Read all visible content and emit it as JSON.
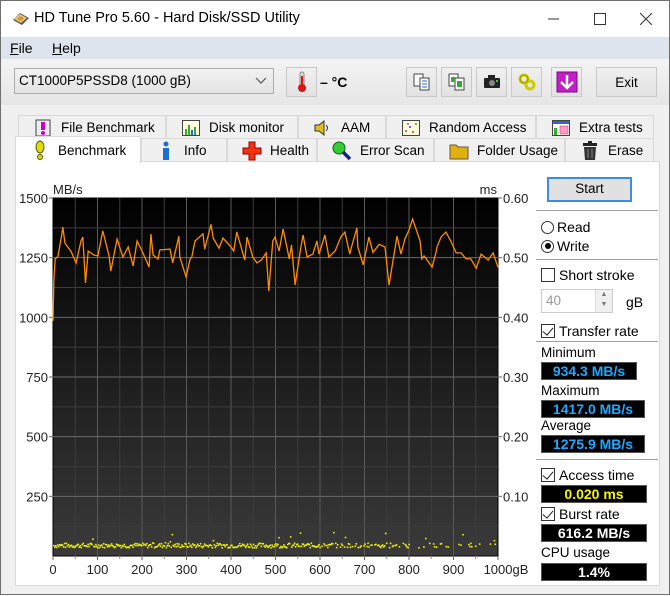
{
  "window": {
    "title": "HD Tune Pro 5.60 - Hard Disk/SSD Utility",
    "icon": "hard-disk-icon",
    "controls": [
      "minimize",
      "maximize",
      "close"
    ]
  },
  "menu": {
    "items": [
      {
        "label": "File",
        "mnemonic": "F",
        "rest": "ile"
      },
      {
        "label": "Help",
        "mnemonic": "H",
        "rest": "elp"
      }
    ]
  },
  "toolbar": {
    "drive": "CT1000P5PSSD8 (1000 gB)",
    "temperature": "– °C",
    "buttons": [
      "copy-text-icon",
      "copy-screenshot-icon",
      "camera-icon",
      "options-icon",
      "save-down-icon"
    ],
    "exit_label": "Exit"
  },
  "tabs": {
    "row1": [
      {
        "label": "File Benchmark",
        "icon": "file-benchmark-icon"
      },
      {
        "label": "Disk monitor",
        "icon": "disk-monitor-icon"
      },
      {
        "label": "AAM",
        "icon": "speaker-icon"
      },
      {
        "label": "Random Access",
        "icon": "random-access-icon"
      },
      {
        "label": "Extra tests",
        "icon": "extra-tests-icon"
      }
    ],
    "row2": [
      {
        "label": "Benchmark",
        "icon": "benchmark-icon",
        "active": true
      },
      {
        "label": "Info",
        "icon": "info-icon"
      },
      {
        "label": "Health",
        "icon": "health-cross-icon"
      },
      {
        "label": "Error Scan",
        "icon": "magnifier-icon"
      },
      {
        "label": "Folder Usage",
        "icon": "folder-icon"
      },
      {
        "label": "Erase",
        "icon": "trash-icon"
      }
    ]
  },
  "side": {
    "start_label": "Start",
    "read_label": "Read",
    "write_label": "Write",
    "mode": "Write",
    "short_stroke_label": "Short stroke",
    "short_stroke_checked": false,
    "short_stroke_value": "40",
    "short_stroke_unit": "gB",
    "transfer_rate_label": "Transfer rate",
    "transfer_rate_checked": true,
    "minimum_label": "Minimum",
    "minimum_value": "934.3 MB/s",
    "maximum_label": "Maximum",
    "maximum_value": "1417.0 MB/s",
    "average_label": "Average",
    "average_value": "1275.9 MB/s",
    "access_time_label": "Access time",
    "access_time_checked": true,
    "access_time_value": "0.020 ms",
    "burst_rate_label": "Burst rate",
    "burst_rate_checked": true,
    "burst_rate_value": "616.2 MB/s",
    "cpu_label": "CPU usage",
    "cpu_value": "1.4%"
  },
  "chart_data": {
    "type": "line",
    "title": "",
    "xlabel": "gB",
    "ylabel_left": "MB/s",
    "ylabel_right": "ms",
    "xlim": [
      0,
      1000
    ],
    "ylim_left": [
      0,
      1500
    ],
    "ylim_right": [
      0,
      0.6
    ],
    "x_ticks": [
      "0",
      "100",
      "200",
      "300",
      "400",
      "500",
      "600",
      "700",
      "800",
      "900",
      "1000gB"
    ],
    "y_ticks_left": [
      "250",
      "500",
      "750",
      "1000",
      "1250",
      "1500"
    ],
    "y_ticks_right": [
      "0.10",
      "0.20",
      "0.30",
      "0.40",
      "0.50",
      "0.60"
    ],
    "grid": true,
    "series": [
      {
        "name": "Transfer rate",
        "axis": "left",
        "color": "#ff8c00",
        "x": [
          0,
          2,
          5,
          11,
          20,
          22,
          27,
          40,
          52,
          63,
          67,
          73,
          79,
          92,
          101,
          112,
          126,
          130,
          144,
          157,
          169,
          180,
          189,
          202,
          216,
          220,
          225,
          236,
          240,
          263,
          269,
          283,
          285,
          299,
          308,
          312,
          319,
          337,
          341,
          355,
          360,
          373,
          382,
          400,
          406,
          413,
          431,
          436,
          449,
          458,
          468,
          479,
          485,
          494,
          499,
          508,
          517,
          531,
          536,
          544,
          557,
          562,
          571,
          584,
          593,
          598,
          611,
          620,
          634,
          647,
          656,
          667,
          670,
          683,
          685,
          697,
          710,
          719,
          733,
          746,
          755,
          773,
          782,
          791,
          800,
          808,
          825,
          829,
          834,
          852,
          861,
          863,
          872,
          883,
          894,
          906,
          917,
          928,
          939,
          951,
          962,
          978,
          989,
          1000
        ],
        "values": [
          985,
          1160,
          1245,
          1255,
          1350,
          1378,
          1310,
          1278,
          1228,
          1320,
          1336,
          1144,
          1278,
          1261,
          1257,
          1362,
          1257,
          1194,
          1328,
          1253,
          1295,
          1215,
          1320,
          1270,
          1211,
          1349,
          1261,
          1245,
          1282,
          1286,
          1228,
          1340,
          1253,
          1169,
          1245,
          1253,
          1320,
          1350,
          1286,
          1390,
          1332,
          1290,
          1332,
          1295,
          1278,
          1358,
          1240,
          1336,
          1253,
          1228,
          1240,
          1270,
          1110,
          1320,
          1336,
          1278,
          1370,
          1245,
          1303,
          1136,
          1295,
          1345,
          1253,
          1265,
          1320,
          1265,
          1345,
          1253,
          1278,
          1337,
          1357,
          1265,
          1290,
          1375,
          1295,
          1220,
          1336,
          1272,
          1306,
          1295,
          1135,
          1340,
          1265,
          1330,
          1366,
          1412,
          1320,
          1245,
          1257,
          1211,
          1274,
          1295,
          1336,
          1357,
          1320,
          1270,
          1270,
          1245,
          1245,
          1206,
          1265,
          1240,
          1270,
          1210
        ]
      },
      {
        "name": "Access time",
        "axis": "right",
        "color": "#f0f000",
        "style": "scatter",
        "typical_value": 0.02,
        "x_range": [
          0,
          1000
        ],
        "values_range": [
          0.015,
          0.028
        ]
      }
    ]
  }
}
